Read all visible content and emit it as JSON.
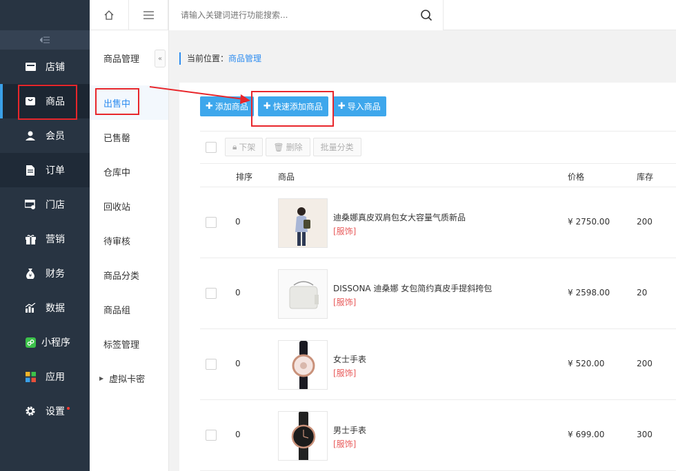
{
  "sidebar": {
    "items": [
      {
        "label": "店铺",
        "icon": "store-icon"
      },
      {
        "label": "商品",
        "icon": "bag-icon"
      },
      {
        "label": "会员",
        "icon": "user-icon"
      },
      {
        "label": "订单",
        "icon": "document-icon"
      },
      {
        "label": "门店",
        "icon": "shop-icon"
      },
      {
        "label": "营销",
        "icon": "gift-icon"
      },
      {
        "label": "财务",
        "icon": "money-bag-icon"
      },
      {
        "label": "数据",
        "icon": "bar-chart-icon"
      },
      {
        "label": "小程序",
        "icon": "mini-program-icon"
      },
      {
        "label": "应用",
        "icon": "apps-icon"
      },
      {
        "label": "设置",
        "icon": "gear-icon"
      }
    ]
  },
  "subnav": {
    "title": "商品管理",
    "items": [
      "出售中",
      "已售罄",
      "仓库中",
      "回收站",
      "待审核",
      "商品分类",
      "商品组",
      "标签管理",
      "虚拟卡密"
    ]
  },
  "topbar": {
    "search_placeholder": "请输入关键词进行功能搜索..."
  },
  "breadcrumb": {
    "prefix": "当前位置：",
    "current": "商品管理"
  },
  "actions": {
    "add": "添加商品",
    "quick_add": "快速添加商品",
    "import": "导入商品"
  },
  "batch": {
    "off_shelf": "下架",
    "delete": "删除",
    "category": "批量分类"
  },
  "table": {
    "headers": {
      "sort": "排序",
      "product": "商品",
      "price": "价格",
      "stock": "库存"
    },
    "rows": [
      {
        "sort": "0",
        "name": "迪桑娜真皮双肩包女大容量气质新品",
        "tag": "[服饰]",
        "price": "¥ 2750.00",
        "stock": "200"
      },
      {
        "sort": "0",
        "name": "DISSONA 迪桑娜 女包简约真皮手提斜挎包",
        "tag": "[服饰]",
        "price": "¥ 2598.00",
        "stock": "20"
      },
      {
        "sort": "0",
        "name": "女士手表",
        "tag": "[服饰]",
        "price": "¥ 520.00",
        "stock": "200"
      },
      {
        "sort": "0",
        "name": "男士手表",
        "tag": "[服饰]",
        "price": "¥ 699.00",
        "stock": "300"
      }
    ]
  },
  "colors": {
    "sidebar_bg": "#283442",
    "accent": "#3ea7ec",
    "annotation": "#e8262b",
    "tag": "#e85a5a"
  }
}
